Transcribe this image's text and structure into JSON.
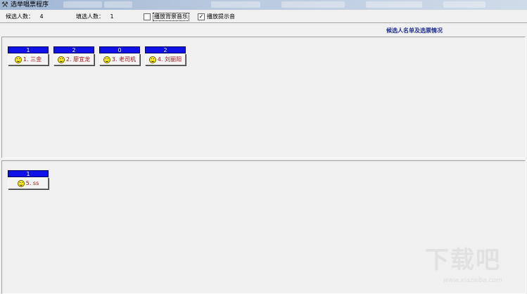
{
  "window": {
    "title": "选举唱票程序",
    "icon": "tools-icon"
  },
  "info": {
    "candidates_label": "候选人数：",
    "candidates_value": "4",
    "selected_label": "填选人数：",
    "selected_value": "1",
    "bgm_label": "播放背景音乐",
    "bgm_checked": false,
    "tone_label": "播放提示音",
    "tone_checked": true
  },
  "list_title": "候选人名单及选票情况",
  "top_candidates": [
    {
      "count": "1",
      "label": "1. 三金"
    },
    {
      "count": "2",
      "label": "2. 廖宜龙"
    },
    {
      "count": "0",
      "label": "3. 老司机"
    },
    {
      "count": "2",
      "label": "4. 刘丽阳"
    }
  ],
  "bottom_candidates": [
    {
      "count": "1",
      "label": "5. ss"
    }
  ],
  "watermark": {
    "logo": "下载吧",
    "url": "www.xiazaiba.com"
  },
  "colors": {
    "count_bg": "#1010e8",
    "name_text": "#a01010",
    "title_text": "#1f2f8f"
  }
}
